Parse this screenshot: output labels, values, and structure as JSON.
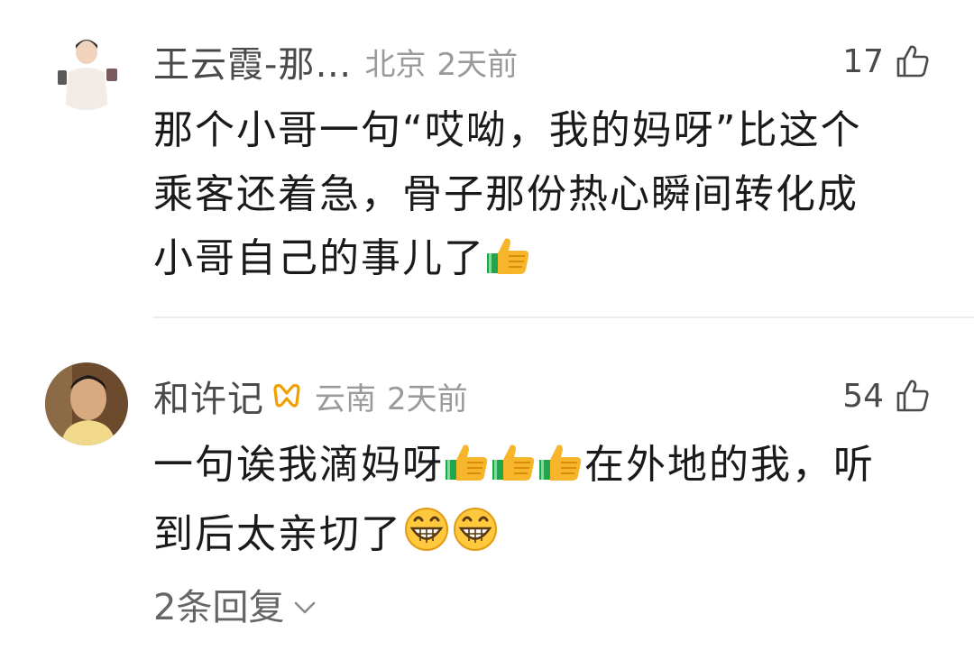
{
  "comments": [
    {
      "username": "王云霞-那…",
      "location": "北京",
      "time": "2天前",
      "likes": "17",
      "lines": [
        "那个小哥一句“哎呦，我的妈呀”比这个",
        "乘客还着急，骨子那份热心瞬间转化成",
        "小哥自己的事儿了"
      ],
      "line_emoji": [
        [
          "thumbs-up"
        ]
      ]
    },
    {
      "username": "和许记",
      "badge_icon": "vip-ribbon-icon",
      "location": "云南",
      "time": "2天前",
      "likes": "54",
      "seg1": "一句诶我滴妈呀",
      "seg2": "在外地的我，听",
      "line2": "到后太亲切了",
      "emoji_sequence_1": [
        "thumbs-up",
        "thumbs-up",
        "thumbs-up"
      ],
      "emoji_sequence_2": [
        "grinning-face",
        "grinning-face"
      ],
      "replies_label": "2条回复"
    }
  ],
  "colors": {
    "username": "#4a4a4a",
    "meta": "#9a9a9a",
    "text": "#1a1a1a",
    "badge": "#f0a000",
    "divider": "#ececec"
  }
}
